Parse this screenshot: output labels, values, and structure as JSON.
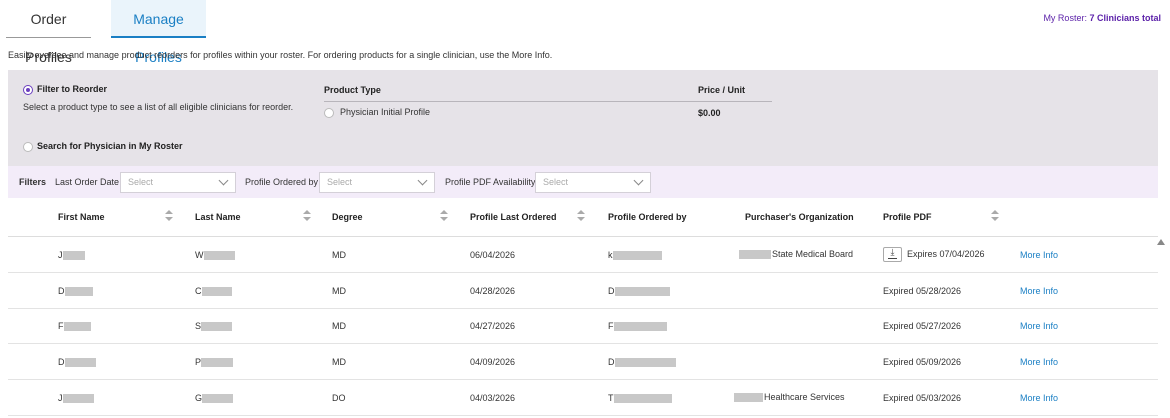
{
  "tabs": {
    "order_profiles": "Order Profiles",
    "manage_profiles": "Manage Profiles"
  },
  "roster": {
    "label": "My Roster:",
    "count": "7 Clinicians total"
  },
  "intro": "Easily oversee and manage product reorders for profiles within your roster. For ordering products for a single clinician, use the More Info.",
  "reorder": {
    "option1_label": "Filter to Reorder",
    "option1_desc": "Select a product type to see a list of all eligible clinicians for reorder.",
    "product_type_header": "Product Type",
    "price_header": "Price / Unit",
    "product_option": "Physician Initial Profile",
    "product_price": "$0.00",
    "option2_label": "Search for Physician in My Roster"
  },
  "filters": {
    "title": "Filters",
    "last_order_date_label": "Last Order Date",
    "profile_ordered_by_label": "Profile Ordered by",
    "pdf_availability_label": "Profile PDF Availability",
    "select_placeholder": "Select"
  },
  "table": {
    "headers": {
      "first_name": "First Name",
      "last_name": "Last Name",
      "degree": "Degree",
      "profile_last_ordered": "Profile Last Ordered",
      "profile_ordered_by": "Profile Ordered by",
      "purchaser_org": "Purchaser's Organization",
      "profile_pdf": "Profile PDF"
    },
    "more_info_label": "More Info",
    "rows": [
      {
        "first": "J",
        "last": "W",
        "degree": "MD",
        "last_ordered": "06/04/2026",
        "ordered_by": "k",
        "org": "State Medical Board",
        "pdf": "Expires 07/04/2026",
        "has_download": true
      },
      {
        "first": "D",
        "last": "C",
        "degree": "MD",
        "last_ordered": "04/28/2026",
        "ordered_by": "D",
        "org": "",
        "pdf": "Expired 05/28/2026",
        "has_download": false
      },
      {
        "first": "F",
        "last": "S",
        "degree": "MD",
        "last_ordered": "04/27/2026",
        "ordered_by": "F",
        "org": "",
        "pdf": "Expired 05/27/2026",
        "has_download": false
      },
      {
        "first": "D",
        "last": "P",
        "degree": "MD",
        "last_ordered": "04/09/2026",
        "ordered_by": "D",
        "org": "",
        "pdf": "Expired 05/09/2026",
        "has_download": false
      },
      {
        "first": "J",
        "last": "G",
        "degree": "DO",
        "last_ordered": "04/03/2026",
        "ordered_by": "T",
        "org": "Healthcare Services",
        "pdf": "Expired 05/03/2026",
        "has_download": false
      }
    ]
  },
  "icons": {
    "download": "download-icon",
    "chevron": "chevron-down-icon",
    "sort": "sort-icon",
    "scroll_up": "scroll-up-arrow-icon"
  },
  "colors": {
    "accent": "#1a7fc4",
    "roster_purple": "#5a1fa8",
    "panel_grey": "#e6e3e8",
    "filters_bg": "#f3ecf9"
  }
}
